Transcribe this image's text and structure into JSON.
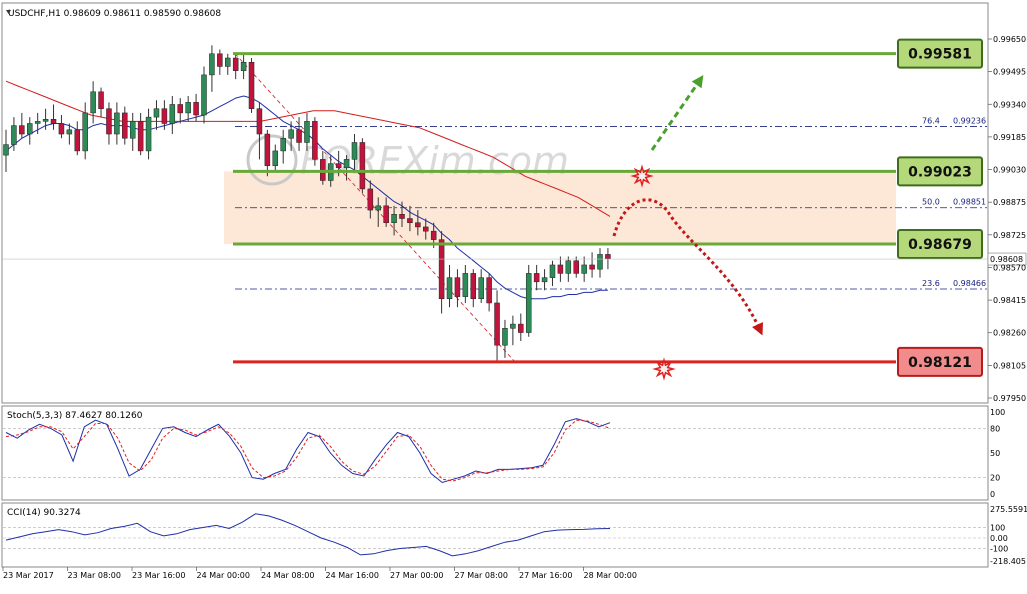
{
  "symbol_header": "USDCHF,H1  0.98609 0.98611 0.98590 0.98608",
  "colors": {
    "bull": "#2e8b57",
    "bear": "#c0143c",
    "green_level": "#6aa83a",
    "red_level": "#d9251d",
    "zone_fill": "#fde3cf",
    "fib_line": "#1a237e",
    "ma_blue": "#1f2fa8",
    "ma_red": "#d41d1d",
    "stoch_main": "#1f2fa8",
    "stoch_signal": "#e02020"
  },
  "price_axis_ticks": [
    "0.99650",
    "0.99495",
    "0.99340",
    "0.99185",
    "0.99030",
    "0.98875",
    "0.98725",
    "0.98570",
    "0.98415",
    "0.98260",
    "0.98105",
    "0.97950"
  ],
  "current_price": "0.98608",
  "levels": [
    {
      "label": "0.99581",
      "price": 0.99581,
      "type": "resistance"
    },
    {
      "label": "0.99023",
      "price": 0.99023,
      "type": "resistance"
    },
    {
      "label": "0.98679",
      "price": 0.98679,
      "type": "resistance"
    },
    {
      "label": "0.98121",
      "price": 0.98121,
      "type": "support"
    }
  ],
  "fib_levels": [
    {
      "pct": "76.4",
      "value": "0.99236",
      "price": 0.99236
    },
    {
      "pct": "50.0",
      "value": "0.98851",
      "price": 0.98851
    },
    {
      "pct": "23.6",
      "value": "0.98466",
      "price": 0.98466
    }
  ],
  "watermark": "FOREXim.com",
  "x_axis_labels": [
    "23 Mar 2017",
    "23 Mar 08:00",
    "23 Mar 16:00",
    "24 Mar 00:00",
    "24 Mar 08:00",
    "24 Mar 16:00",
    "27 Mar 00:00",
    "27 Mar 08:00",
    "27 Mar 16:00",
    "28 Mar 00:00"
  ],
  "stoch": {
    "label": "Stoch(5,3,3) 87.4627 80.1260",
    "ticks": [
      "100",
      "80",
      "50",
      "20",
      "0"
    ]
  },
  "cci": {
    "label": "CCI(14) 90.3274",
    "ticks": [
      "275.5591",
      "100",
      "0.00",
      "-100",
      "-218.4051"
    ]
  },
  "chart_data": {
    "type": "candlestick",
    "candles": [
      {
        "o": 0.991,
        "h": 0.9922,
        "l": 0.9902,
        "c": 0.9915
      },
      {
        "o": 0.9915,
        "h": 0.9928,
        "l": 0.9912,
        "c": 0.9924
      },
      {
        "o": 0.9924,
        "h": 0.993,
        "l": 0.9918,
        "c": 0.992
      },
      {
        "o": 0.992,
        "h": 0.9928,
        "l": 0.9915,
        "c": 0.9925
      },
      {
        "o": 0.9925,
        "h": 0.993,
        "l": 0.992,
        "c": 0.9926
      },
      {
        "o": 0.9926,
        "h": 0.9932,
        "l": 0.9922,
        "c": 0.9927
      },
      {
        "o": 0.9927,
        "h": 0.9934,
        "l": 0.9922,
        "c": 0.9925
      },
      {
        "o": 0.9925,
        "h": 0.9929,
        "l": 0.9918,
        "c": 0.992
      },
      {
        "o": 0.992,
        "h": 0.9925,
        "l": 0.9915,
        "c": 0.9922
      },
      {
        "o": 0.9922,
        "h": 0.9926,
        "l": 0.991,
        "c": 0.9912
      },
      {
        "o": 0.9912,
        "h": 0.9935,
        "l": 0.9908,
        "c": 0.993
      },
      {
        "o": 0.993,
        "h": 0.9945,
        "l": 0.9925,
        "c": 0.994
      },
      {
        "o": 0.994,
        "h": 0.9942,
        "l": 0.9928,
        "c": 0.9932
      },
      {
        "o": 0.9932,
        "h": 0.9935,
        "l": 0.9915,
        "c": 0.992
      },
      {
        "o": 0.992,
        "h": 0.9935,
        "l": 0.9915,
        "c": 0.993
      },
      {
        "o": 0.993,
        "h": 0.9933,
        "l": 0.9915,
        "c": 0.9918
      },
      {
        "o": 0.9918,
        "h": 0.993,
        "l": 0.9912,
        "c": 0.9926
      },
      {
        "o": 0.9926,
        "h": 0.993,
        "l": 0.991,
        "c": 0.9912
      },
      {
        "o": 0.9912,
        "h": 0.9932,
        "l": 0.9908,
        "c": 0.9928
      },
      {
        "o": 0.9928,
        "h": 0.9936,
        "l": 0.9922,
        "c": 0.9932
      },
      {
        "o": 0.9932,
        "h": 0.9936,
        "l": 0.9922,
        "c": 0.9925
      },
      {
        "o": 0.9925,
        "h": 0.9938,
        "l": 0.992,
        "c": 0.9934
      },
      {
        "o": 0.9934,
        "h": 0.9937,
        "l": 0.9925,
        "c": 0.993
      },
      {
        "o": 0.993,
        "h": 0.9938,
        "l": 0.9926,
        "c": 0.9935
      },
      {
        "o": 0.9935,
        "h": 0.9939,
        "l": 0.9926,
        "c": 0.9929
      },
      {
        "o": 0.9929,
        "h": 0.9952,
        "l": 0.9925,
        "c": 0.9948
      },
      {
        "o": 0.9948,
        "h": 0.9962,
        "l": 0.994,
        "c": 0.9958
      },
      {
        "o": 0.9958,
        "h": 0.996,
        "l": 0.9948,
        "c": 0.9952
      },
      {
        "o": 0.9952,
        "h": 0.9958,
        "l": 0.9948,
        "c": 0.9956
      },
      {
        "o": 0.9956,
        "h": 0.9958,
        "l": 0.9946,
        "c": 0.995
      },
      {
        "o": 0.995,
        "h": 0.9958,
        "l": 0.9946,
        "c": 0.9954
      },
      {
        "o": 0.9954,
        "h": 0.9956,
        "l": 0.993,
        "c": 0.9932
      },
      {
        "o": 0.9932,
        "h": 0.9935,
        "l": 0.9908,
        "c": 0.992
      },
      {
        "o": 0.992,
        "h": 0.9922,
        "l": 0.99,
        "c": 0.9905
      },
      {
        "o": 0.9905,
        "h": 0.9915,
        "l": 0.9902,
        "c": 0.9912
      },
      {
        "o": 0.9912,
        "h": 0.9922,
        "l": 0.9906,
        "c": 0.9918
      },
      {
        "o": 0.9918,
        "h": 0.9926,
        "l": 0.9912,
        "c": 0.9922
      },
      {
        "o": 0.9922,
        "h": 0.9928,
        "l": 0.9912,
        "c": 0.9916
      },
      {
        "o": 0.9916,
        "h": 0.993,
        "l": 0.9912,
        "c": 0.9926
      },
      {
        "o": 0.9926,
        "h": 0.9928,
        "l": 0.9905,
        "c": 0.9908
      },
      {
        "o": 0.9908,
        "h": 0.9912,
        "l": 0.9896,
        "c": 0.9898
      },
      {
        "o": 0.9898,
        "h": 0.991,
        "l": 0.9895,
        "c": 0.9906
      },
      {
        "o": 0.9906,
        "h": 0.9912,
        "l": 0.99,
        "c": 0.9904
      },
      {
        "o": 0.9904,
        "h": 0.991,
        "l": 0.9898,
        "c": 0.9908
      },
      {
        "o": 0.9908,
        "h": 0.992,
        "l": 0.9902,
        "c": 0.9916
      },
      {
        "o": 0.9916,
        "h": 0.9918,
        "l": 0.9892,
        "c": 0.9894
      },
      {
        "o": 0.9894,
        "h": 0.9898,
        "l": 0.988,
        "c": 0.9884
      },
      {
        "o": 0.9884,
        "h": 0.989,
        "l": 0.9876,
        "c": 0.9886
      },
      {
        "o": 0.9886,
        "h": 0.989,
        "l": 0.9876,
        "c": 0.9878
      },
      {
        "o": 0.9878,
        "h": 0.9886,
        "l": 0.9872,
        "c": 0.9882
      },
      {
        "o": 0.9882,
        "h": 0.9888,
        "l": 0.9876,
        "c": 0.988
      },
      {
        "o": 0.988,
        "h": 0.9886,
        "l": 0.9874,
        "c": 0.9878
      },
      {
        "o": 0.9878,
        "h": 0.9884,
        "l": 0.9872,
        "c": 0.9876
      },
      {
        "o": 0.9876,
        "h": 0.988,
        "l": 0.987,
        "c": 0.9874
      },
      {
        "o": 0.9874,
        "h": 0.9878,
        "l": 0.9866,
        "c": 0.987
      },
      {
        "o": 0.987,
        "h": 0.9874,
        "l": 0.9835,
        "c": 0.9842
      },
      {
        "o": 0.9842,
        "h": 0.9858,
        "l": 0.9838,
        "c": 0.9852
      },
      {
        "o": 0.9852,
        "h": 0.9856,
        "l": 0.9838,
        "c": 0.9843
      },
      {
        "o": 0.9843,
        "h": 0.9858,
        "l": 0.984,
        "c": 0.9854
      },
      {
        "o": 0.9854,
        "h": 0.9856,
        "l": 0.9838,
        "c": 0.9842
      },
      {
        "o": 0.9842,
        "h": 0.9856,
        "l": 0.984,
        "c": 0.9852
      },
      {
        "o": 0.9852,
        "h": 0.9854,
        "l": 0.9836,
        "c": 0.984
      },
      {
        "o": 0.984,
        "h": 0.9846,
        "l": 0.9812,
        "c": 0.982
      },
      {
        "o": 0.982,
        "h": 0.9832,
        "l": 0.9814,
        "c": 0.9828
      },
      {
        "o": 0.9828,
        "h": 0.9834,
        "l": 0.982,
        "c": 0.983
      },
      {
        "o": 0.983,
        "h": 0.9835,
        "l": 0.9822,
        "c": 0.9826
      },
      {
        "o": 0.9826,
        "h": 0.9858,
        "l": 0.9824,
        "c": 0.9854
      },
      {
        "o": 0.9854,
        "h": 0.9858,
        "l": 0.9846,
        "c": 0.985
      },
      {
        "o": 0.985,
        "h": 0.9856,
        "l": 0.9846,
        "c": 0.9852
      },
      {
        "o": 0.9852,
        "h": 0.986,
        "l": 0.9848,
        "c": 0.9858
      },
      {
        "o": 0.9858,
        "h": 0.9862,
        "l": 0.985,
        "c": 0.9854
      },
      {
        "o": 0.9854,
        "h": 0.9862,
        "l": 0.985,
        "c": 0.986
      },
      {
        "o": 0.986,
        "h": 0.9862,
        "l": 0.9852,
        "c": 0.9854
      },
      {
        "o": 0.9854,
        "h": 0.9862,
        "l": 0.985,
        "c": 0.9858
      },
      {
        "o": 0.9858,
        "h": 0.9864,
        "l": 0.9852,
        "c": 0.9856
      },
      {
        "o": 0.9856,
        "h": 0.9866,
        "l": 0.9852,
        "c": 0.9863
      },
      {
        "o": 0.9863,
        "h": 0.9866,
        "l": 0.9856,
        "c": 0.9861
      }
    ],
    "ma_blue": [
      0.9912,
      0.9915,
      0.9918,
      0.992,
      0.9922,
      0.9924,
      0.9925,
      0.9925,
      0.9924,
      0.9922,
      0.9922,
      0.9924,
      0.9925,
      0.9924,
      0.9924,
      0.9924,
      0.9923,
      0.9922,
      0.9922,
      0.9923,
      0.9924,
      0.9925,
      0.9926,
      0.9927,
      0.9928,
      0.9929,
      0.9931,
      0.9933,
      0.9935,
      0.9937,
      0.9938,
      0.9937,
      0.9935,
      0.9932,
      0.9929,
      0.9926,
      0.9924,
      0.9922,
      0.992,
      0.9917,
      0.9913,
      0.991,
      0.9907,
      0.9905,
      0.9903,
      0.99,
      0.9897,
      0.9894,
      0.9891,
      0.9888,
      0.9886,
      0.9883,
      0.9881,
      0.9879,
      0.9877,
      0.9873,
      0.987,
      0.9866,
      0.9863,
      0.986,
      0.9857,
      0.9854,
      0.985,
      0.9847,
      0.9845,
      0.9843,
      0.9842,
      0.9842,
      0.9842,
      0.9843,
      0.9843,
      0.9844,
      0.9844,
      0.9845,
      0.9845,
      0.9846,
      0.9846
    ],
    "ma_red": [
      0.9945,
      0.9943,
      0.9941,
      0.9939,
      0.9937,
      0.9935,
      0.9933,
      0.9931,
      0.9929,
      0.9928,
      0.9927,
      0.9926,
      0.9926,
      0.9926,
      0.9926,
      0.9926,
      0.9926,
      0.9926,
      0.9926,
      0.9926,
      0.9926,
      0.9926,
      0.9926,
      0.9926,
      0.9926,
      0.9927,
      0.9928,
      0.9929,
      0.993,
      0.9931,
      0.9931,
      0.9931,
      0.993,
      0.9929,
      0.9928,
      0.9927,
      0.9926,
      0.9925,
      0.9924,
      0.9923,
      0.9921,
      0.9919,
      0.9917,
      0.9915,
      0.9913,
      0.9911,
      0.9909,
      0.9906,
      0.9903,
      0.99,
      0.9898,
      0.9896,
      0.9894,
      0.9892,
      0.989,
      0.9887,
      0.9884,
      0.9881
    ],
    "stoch_main": [
      75,
      68,
      78,
      85,
      80,
      72,
      40,
      82,
      90,
      85,
      55,
      22,
      30,
      55,
      80,
      82,
      75,
      70,
      78,
      85,
      70,
      50,
      20,
      18,
      25,
      30,
      55,
      75,
      70,
      50,
      35,
      25,
      22,
      42,
      60,
      75,
      70,
      50,
      25,
      14,
      18,
      22,
      28,
      25,
      30,
      30,
      31,
      32,
      35,
      60,
      88,
      92,
      88,
      82,
      87
    ],
    "stoch_signal": [
      70,
      72,
      76,
      82,
      82,
      76,
      55,
      70,
      86,
      86,
      68,
      38,
      28,
      42,
      68,
      80,
      78,
      72,
      76,
      82,
      74,
      58,
      32,
      20,
      22,
      28,
      45,
      68,
      72,
      58,
      40,
      28,
      24,
      34,
      52,
      70,
      72,
      58,
      35,
      18,
      16,
      20,
      26,
      26,
      28,
      30,
      30,
      31,
      33,
      50,
      78,
      90,
      89,
      85,
      80
    ],
    "cci": [
      -20,
      10,
      40,
      60,
      80,
      60,
      30,
      50,
      90,
      110,
      140,
      60,
      20,
      40,
      80,
      100,
      120,
      90,
      150,
      230,
      210,
      170,
      120,
      60,
      0,
      -40,
      -90,
      -160,
      -150,
      -120,
      -100,
      -90,
      -80,
      -120,
      -170,
      -150,
      -120,
      -80,
      -40,
      -20,
      20,
      60,
      75,
      80,
      82,
      88,
      90
    ]
  }
}
